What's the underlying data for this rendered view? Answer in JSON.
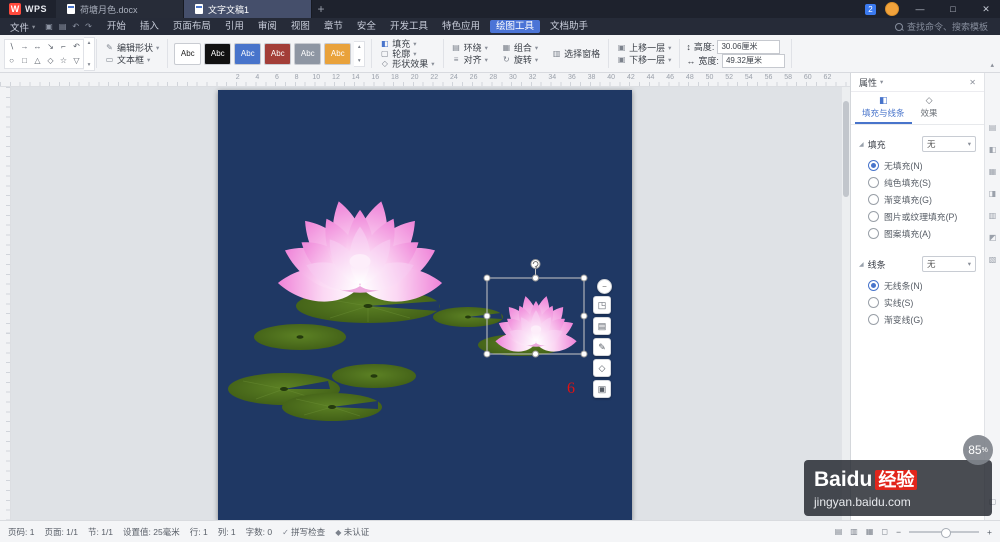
{
  "titlebar": {
    "logo_letter": "W",
    "logo_text": "WPS",
    "tabs": [
      {
        "label": "荷塘月色.docx",
        "active": false
      },
      {
        "label": "文字文稿1",
        "active": true
      }
    ],
    "new_tab_glyph": "+",
    "badge": "2",
    "window_min": "—",
    "window_max": "□",
    "window_close": "✕"
  },
  "menubar": {
    "file_label": "文件",
    "file_caret": "▾",
    "quick_icons": [
      "▣",
      "▤",
      "↶",
      "↷"
    ],
    "items": [
      "开始",
      "插入",
      "页面布局",
      "引用",
      "审阅",
      "视图",
      "章节",
      "安全",
      "开发工具",
      "特色应用",
      "绘图工具",
      "文档助手"
    ],
    "active_item": "绘图工具",
    "search_text": "查找命令、搜索模板"
  },
  "ribbon": {
    "gallery_row1": [
      "∖",
      "→",
      "↔",
      "↘",
      "⌐",
      "↶"
    ],
    "gallery_row2": [
      "○",
      "□",
      "△",
      "◇",
      "☆",
      "▽"
    ],
    "gallery_up": "▴",
    "gallery_down": "▾",
    "edit_shape_label": "编辑形状",
    "textbox_label": "文本框",
    "swatches": [
      {
        "label": "Abc",
        "bg": "#ffffff",
        "fg": "#222222"
      },
      {
        "label": "Abc",
        "bg": "#111111",
        "fg": "#ffffff"
      },
      {
        "label": "Abc",
        "bg": "#4874cb",
        "fg": "#ffffff"
      },
      {
        "label": "Abc",
        "bg": "#a33e38",
        "fg": "#ffffff"
      },
      {
        "label": "Abc",
        "bg": "#8e96a3",
        "fg": "#ffffff"
      },
      {
        "label": "Abc",
        "bg": "#e9a23b",
        "fg": "#ffffff"
      }
    ],
    "fill_label": "填充",
    "outline_label": "轮廓",
    "effects_label": "形状效果",
    "wrap_label": "环绕",
    "align_label": "对齐",
    "group_label": "组合",
    "rotate_label": "旋转",
    "selection_pane_label": "选择窗格",
    "bring_forward_label": "上移一层",
    "send_backward_label": "下移一层",
    "height_label": "高度:",
    "height_value": "30.06厘米",
    "width_label": "宽度:",
    "width_value": "49.32厘米"
  },
  "ruler": {
    "numbers": [
      2,
      4,
      6,
      8,
      10,
      12,
      14,
      16,
      18,
      20,
      22,
      24,
      26,
      28,
      30,
      32,
      34,
      36,
      38,
      40,
      42,
      44,
      46,
      48,
      50,
      52,
      54,
      56,
      58,
      60,
      62
    ]
  },
  "canvas": {
    "page_color": "#1f3864",
    "annotation": "6",
    "annotation_color": "#e01212"
  },
  "quickbar": {
    "collapse_glyph": "−",
    "tools": [
      "◳",
      "▤",
      "✎",
      "◇",
      "▣"
    ]
  },
  "panel": {
    "title": "属性",
    "title_caret": "▾",
    "close_glyph": "✕",
    "tab_fill_line": "填充与线条",
    "tab_effects": "效果",
    "section_glyph": "◢",
    "fill": {
      "header": "填充",
      "value": "无",
      "options": [
        "无填充(N)",
        "纯色填充(S)",
        "渐变填充(G)",
        "图片或纹理填充(P)",
        "图案填充(A)"
      ],
      "selected": "无填充(N)"
    },
    "line": {
      "header": "线条",
      "value": "无",
      "options": [
        "无线条(N)",
        "实线(S)",
        "渐变线(G)"
      ],
      "selected": "无线条(N)"
    }
  },
  "side_strip": {
    "icons": [
      "▤",
      "◧",
      "▦",
      "◨",
      "▥",
      "◩",
      "▧"
    ],
    "bottom_icon": "▢"
  },
  "statusbar": {
    "left_items": [
      "页码: 1",
      "页面: 1/1",
      "节: 1/1",
      "设置值: 25毫米",
      "行: 1",
      "列: 1",
      "字数: 0"
    ],
    "spellcheck_label": "拼写检查",
    "spellcheck_icon": "✓",
    "cert_label": "未认证",
    "cert_icon": "◆",
    "view_icons": [
      "▤",
      "▥",
      "▦",
      "◻"
    ],
    "zoom_minus": "−",
    "zoom_plus": "+"
  },
  "watermark": {
    "brand_latin": "Baidu",
    "brand_cn": "经验",
    "url": "jingyan.baidu.com",
    "badge_value": "85",
    "badge_unit": "%"
  }
}
